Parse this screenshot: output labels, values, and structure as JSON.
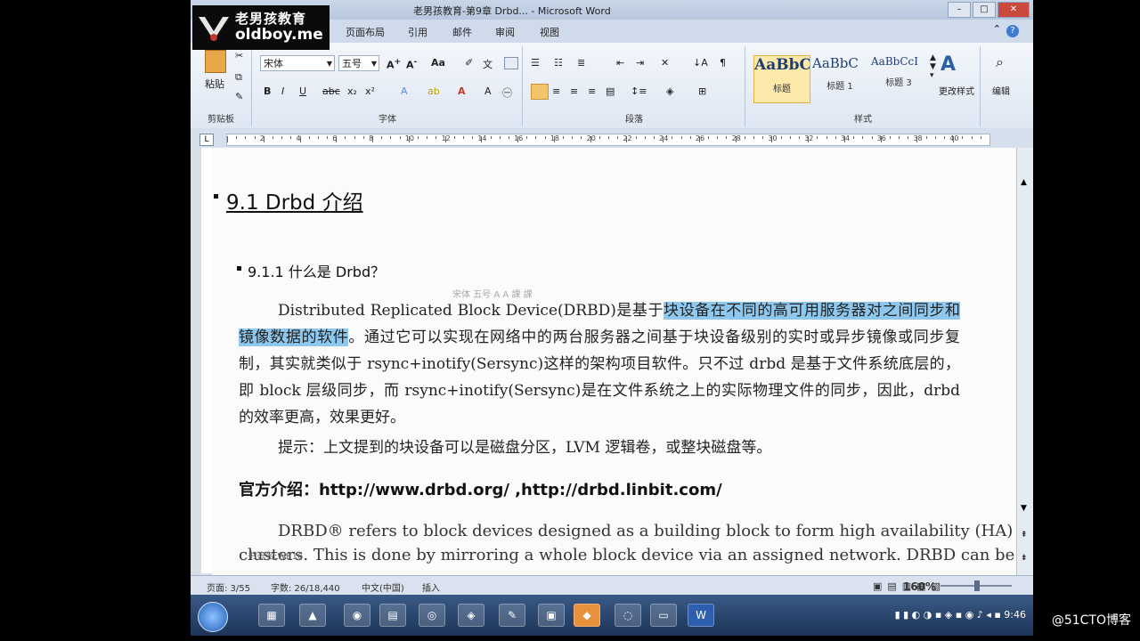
{
  "overlay": {
    "logo_cn": "老男孩教育",
    "logo_en": "oldboy.me",
    "watermark": "@51CTO博客"
  },
  "window": {
    "title": "老男孩教育-第9章 Drbd... - Microsoft Word"
  },
  "tabs": [
    "页面布局",
    "引用",
    "邮件",
    "审阅",
    "视图"
  ],
  "ribbon": {
    "clipboard": {
      "paste": "粘贴",
      "group": "剪贴板"
    },
    "font": {
      "name": "宋体",
      "size": "五号",
      "group": "字体"
    },
    "paragraph": {
      "group": "段落"
    },
    "styles": {
      "group": "样式",
      "items": [
        {
          "preview": "AaBbC",
          "label": "标题"
        },
        {
          "preview": "AaBbC",
          "label": "标题 1"
        },
        {
          "preview": "AaBbCcI",
          "label": "标题 3"
        }
      ],
      "change": "更改样式",
      "edit": "编辑"
    }
  },
  "ruler_numbers": [
    "2",
    "4",
    "6",
    "8",
    "10",
    "12",
    "14",
    "16",
    "18",
    "20",
    "22",
    "24",
    "26",
    "28",
    "30",
    "32",
    "34",
    "36",
    "38",
    "40"
  ],
  "document": {
    "h1": "9.1 Drbd 介绍",
    "h2": "9.1.1  什么是 Drbd？",
    "mini_toolbar": "宋体   五号  A  A  課 課",
    "p1_start": "Distributed Replicated Block Device(DRBD)是基于",
    "p1_highlight": "块设备在不同的高可用服务器对之间同步和镜像数据的软件",
    "p1_rest": "。通过它可以实现在网络中的两台服务器之间基于块设备级别的实时或异步镜像或同步复制，其实就类似于 rsync+inotify(Sersync)这样的架构项目软件。只不过 drbd 是基于文件系统底层的，即 block 层级同步，而 rsync+inotify(Sersync)是在文件系统之上的实际物理文件的同步，因此，drbd 的效率更高，效果更好。",
    "tip": "提示：上文提到的块设备可以是磁盘分区，LVM 逻辑卷，或整块磁盘等。",
    "official": "官方介绍：http://www.drbd.org/ ,http://drbd.linbit.com/",
    "drbd_line1": "DRBD® refers to block devices designed as a building block to form high availability (HA)",
    "drbd_line2": "clusters. This is done by mirroring a whole block device via an assigned network. DRBD can be",
    "bookmark": "书签名:WE16"
  },
  "status": {
    "page": "页面: 3/55",
    "words": "字数: 26/18,440",
    "lang": "中文(中国)",
    "mode": "插入",
    "zoom": "160%"
  },
  "taskbar": {
    "time": "9:46"
  }
}
